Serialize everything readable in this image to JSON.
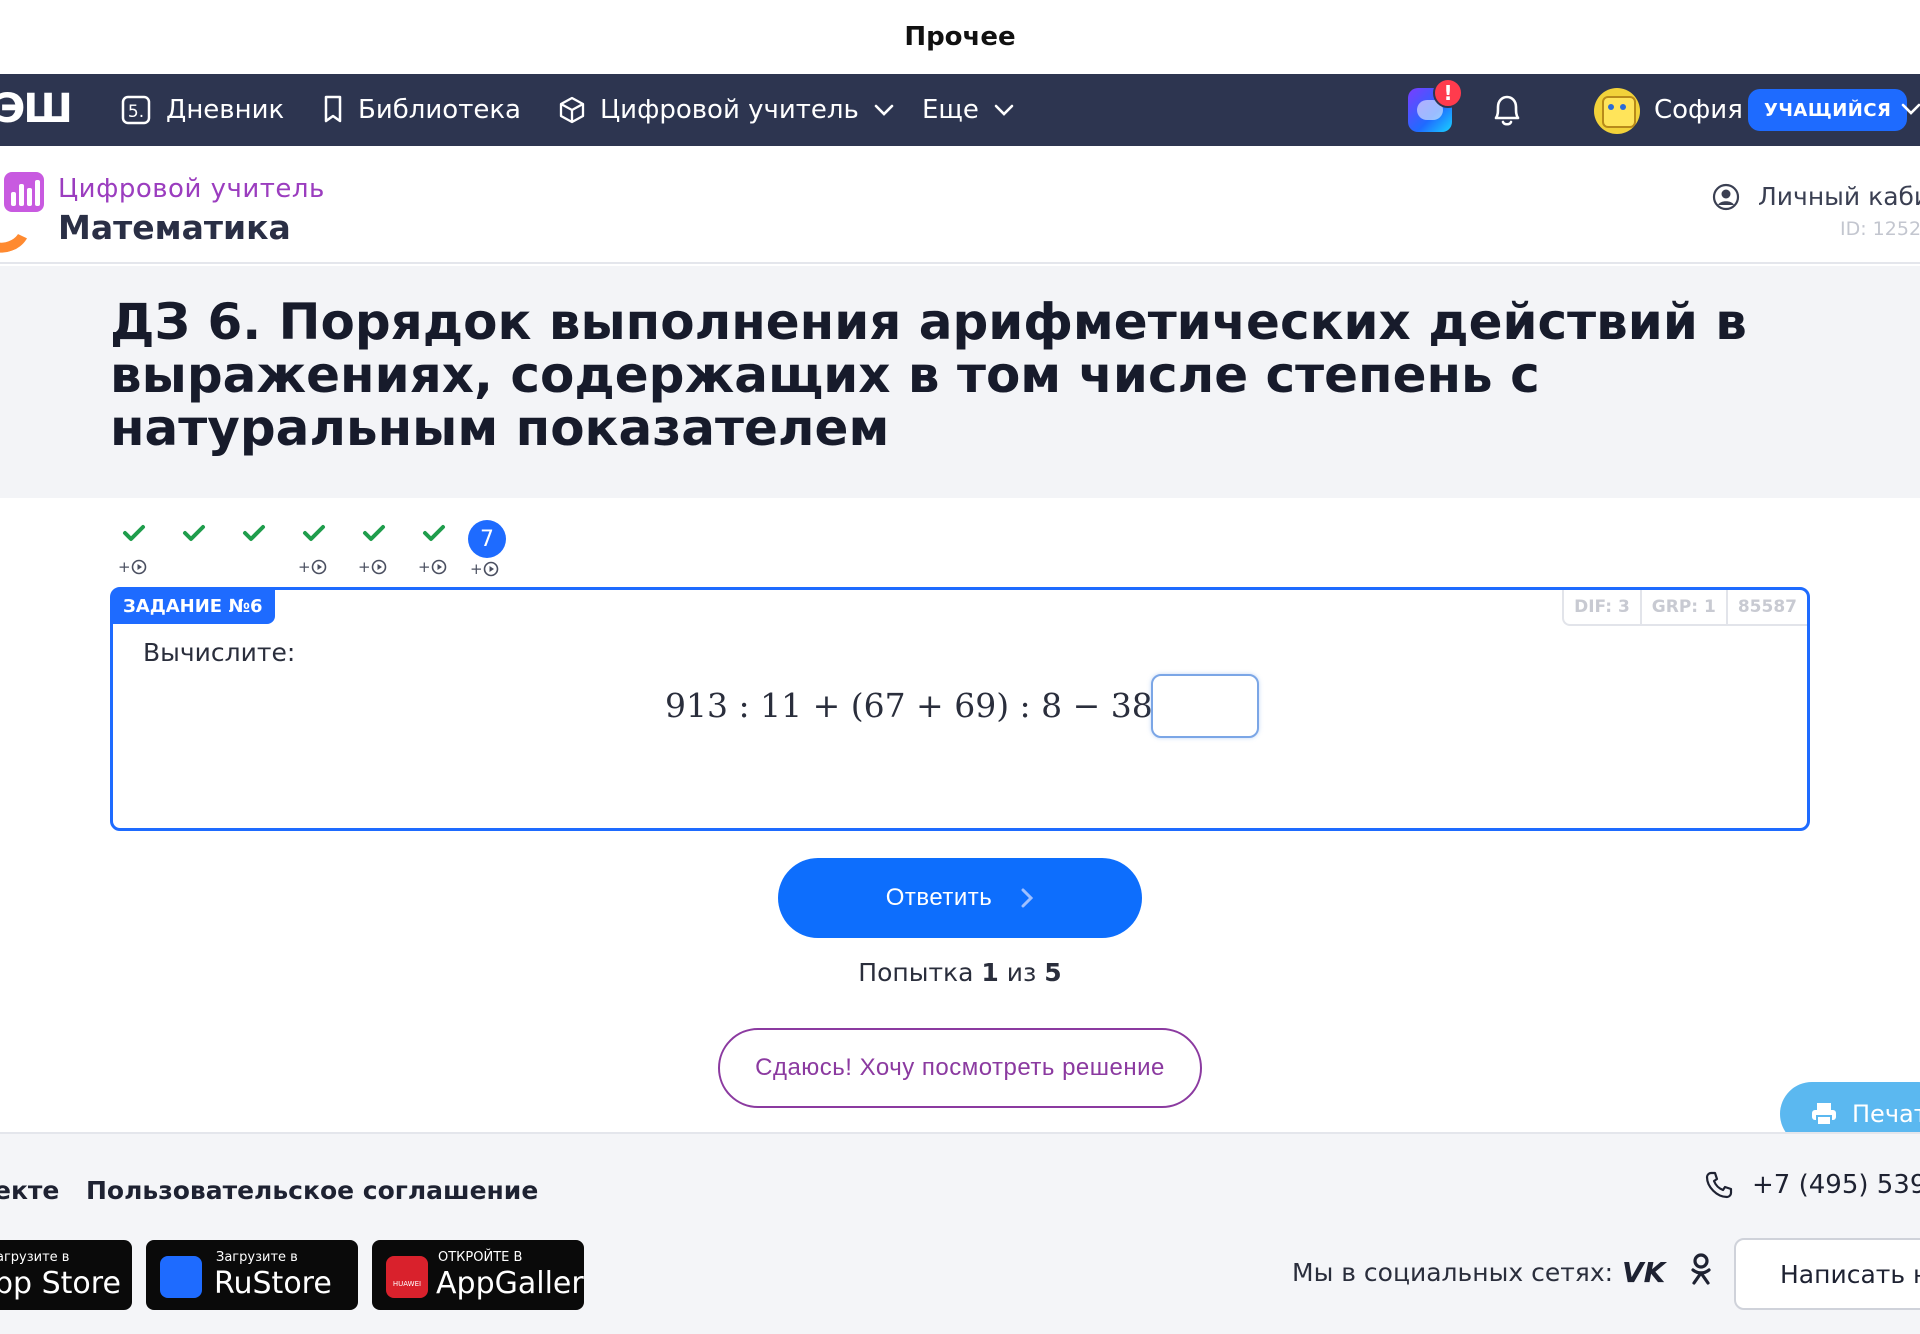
{
  "window": {
    "title": "Прочее"
  },
  "nav": {
    "logo": "ЭШ",
    "items": [
      {
        "label": "Дневник",
        "icon": "diary-icon"
      },
      {
        "label": "Библиотека",
        "icon": "bookmark-icon"
      },
      {
        "label": "Цифровой учитель",
        "icon": "cube-icon",
        "has_dropdown": true
      },
      {
        "label": "Еще",
        "has_dropdown": true
      }
    ],
    "alert_badge": "!",
    "user_name": "София",
    "user_role": "УЧАЩИЙСЯ"
  },
  "subheader": {
    "brand_top": "Цифровой учитель",
    "brand_main": "Математика",
    "cabinet_label": "Личный каби",
    "user_id": "ID: 1252"
  },
  "page": {
    "title": "ДЗ 6. Порядок выполнения арифметических действий в выражениях, содержащих в том числе степень с натуральным показателем"
  },
  "steps": [
    {
      "status": "done",
      "bonus": "+"
    },
    {
      "status": "done"
    },
    {
      "status": "done"
    },
    {
      "status": "done",
      "bonus": "+"
    },
    {
      "status": "done",
      "bonus": "+"
    },
    {
      "status": "done",
      "bonus": "+"
    },
    {
      "status": "current",
      "number": "7",
      "bonus": "+"
    }
  ],
  "task": {
    "label": "ЗАДАНИЕ №6",
    "meta": [
      "DIF: 3",
      "GRP: 1",
      "85587"
    ],
    "prompt": "Вычислите:",
    "expression": "913 : 11 + (67 + 69) : 8 − 38 =",
    "answer_value": ""
  },
  "actions": {
    "answer_label": "Ответить",
    "attempt_prefix": "Попытка",
    "attempt_current": "1",
    "attempt_mid": "из",
    "attempt_total": "5",
    "giveup_label": "Сдаюсь! Хочу посмотреть решение",
    "print_label": "Печат"
  },
  "footer": {
    "link_partial": "екте",
    "agreement": "Пользовательское соглашение",
    "phone": "+7 (495) 539-",
    "stores": [
      {
        "small": "агрузите в",
        "big": "pp Store"
      },
      {
        "small": "Загрузите в",
        "big": "RuStore"
      },
      {
        "small": "ОТКРОЙТЕ В",
        "big": "AppGallery",
        "brand": "HUAWEI"
      }
    ],
    "social_label": "Мы в социальных сетях:",
    "vk": "VK",
    "write_label": "Написать н"
  },
  "colors": {
    "nav_bg": "#2d3550",
    "accent": "#1e6bff",
    "purple": "#8b3aa0",
    "success": "#1f9d4c"
  }
}
